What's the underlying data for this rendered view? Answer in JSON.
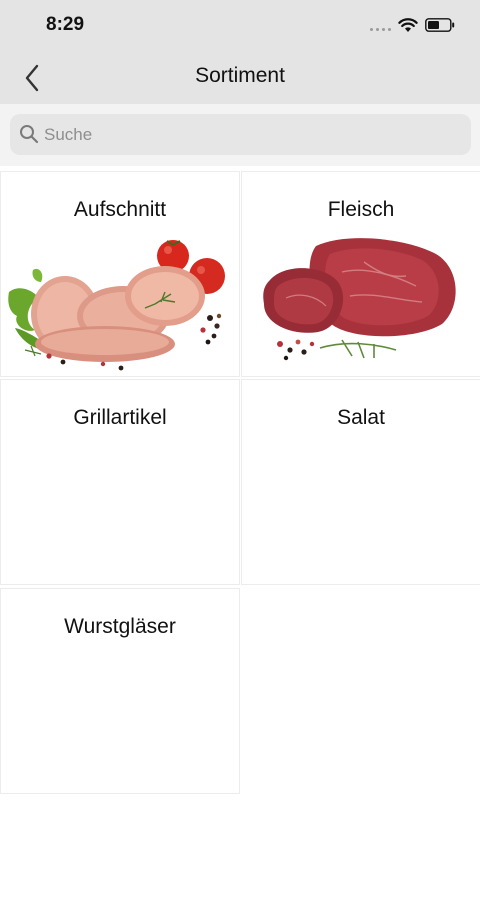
{
  "status_bar": {
    "time": "8:29"
  },
  "nav": {
    "title": "Sortiment",
    "back_icon": "chevron-left-icon"
  },
  "search": {
    "placeholder": "Suche",
    "value": "",
    "icon": "search-icon"
  },
  "categories": [
    {
      "label": "Aufschnitt",
      "image": "cold-cuts-image"
    },
    {
      "label": "Fleisch",
      "image": "raw-meat-image"
    },
    {
      "label": "Grillartikel",
      "image": ""
    },
    {
      "label": "Salat",
      "image": ""
    },
    {
      "label": "Wurstgläser",
      "image": ""
    }
  ],
  "colors": {
    "header_bg": "#e4e4e4",
    "search_bg": "#e6e6e6",
    "meat_red": "#a8323c",
    "ham_pink": "#e3a391",
    "tomato_red": "#d8281e",
    "lettuce_green": "#6aa72c"
  }
}
